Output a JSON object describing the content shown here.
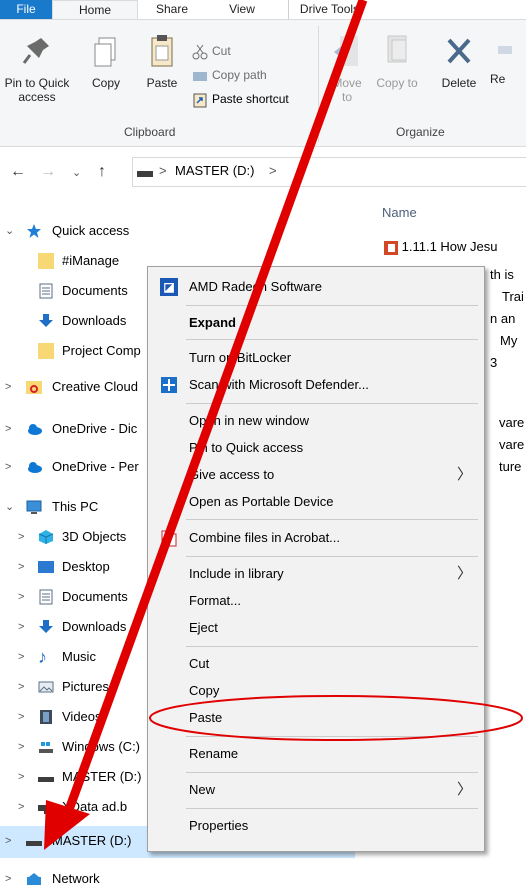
{
  "tabs": {
    "file": "File",
    "home": "Home",
    "share": "Share",
    "view": "View",
    "drive_tools": "Drive Tools"
  },
  "ribbon": {
    "pin": "Pin to Quick access",
    "copy": "Copy",
    "paste": "Paste",
    "cut": "Cut",
    "copy_path": "Copy path",
    "paste_shortcut": "Paste shortcut",
    "move_to": "Move to",
    "copy_to": "Copy to",
    "delete": "Delete",
    "rename_partial": "Re",
    "group_clipboard": "Clipboard",
    "group_organize": "Organize"
  },
  "address": {
    "drive_segment": "MASTER (D:)",
    "separator": ">"
  },
  "nav": {
    "quick_access": "Quick access",
    "imanage": "#iManage",
    "documents": "Documents",
    "downloads": "Downloads",
    "project": "Project Comp",
    "creative_cloud": "Creative Cloud",
    "onedrive_1": "OneDrive - Dic",
    "onedrive_2": "OneDrive - Per",
    "this_pc": "This PC",
    "objects_3d": "3D Objects",
    "desktop": "Desktop",
    "pc_documents": "Documents",
    "pc_downloads": "Downloads",
    "music": "Music",
    "pictures": "Pictures",
    "videos": "Videos",
    "windows_c": "Windows (C:)",
    "master_d": "MASTER (D:)",
    "xdata": "XData ad.b",
    "master_d_selected": "MASTER (D:)",
    "network": "Network"
  },
  "files": {
    "column_name": "Name",
    "f1": "1.11.1 How Jesu",
    "f2": "th is",
    "f3": "Trai",
    "f4": "n an",
    "f5": "My",
    "f6": "3",
    "f7": "vare",
    "f8": "vare",
    "f9": "ture"
  },
  "context_menu": {
    "amd": "AMD Radeon Software",
    "expand": "Expand",
    "bitlocker": "Turn on BitLocker",
    "defender": "Scan with Microsoft Defender...",
    "open_new": "Open in new window",
    "pin_quick": "Pin to Quick access",
    "give_access": "Give access to",
    "portable": "Open as Portable Device",
    "acrobat": "Combine files in Acrobat...",
    "include_library": "Include in library",
    "format": "Format...",
    "eject": "Eject",
    "cut": "Cut",
    "copy": "Copy",
    "paste": "Paste",
    "rename": "Rename",
    "new": "New",
    "properties": "Properties"
  },
  "colors": {
    "file_tab": "#1979ca",
    "selection": "#cde8ff",
    "annotation": "#e00000",
    "menu_bg": "#f2f2f2"
  }
}
